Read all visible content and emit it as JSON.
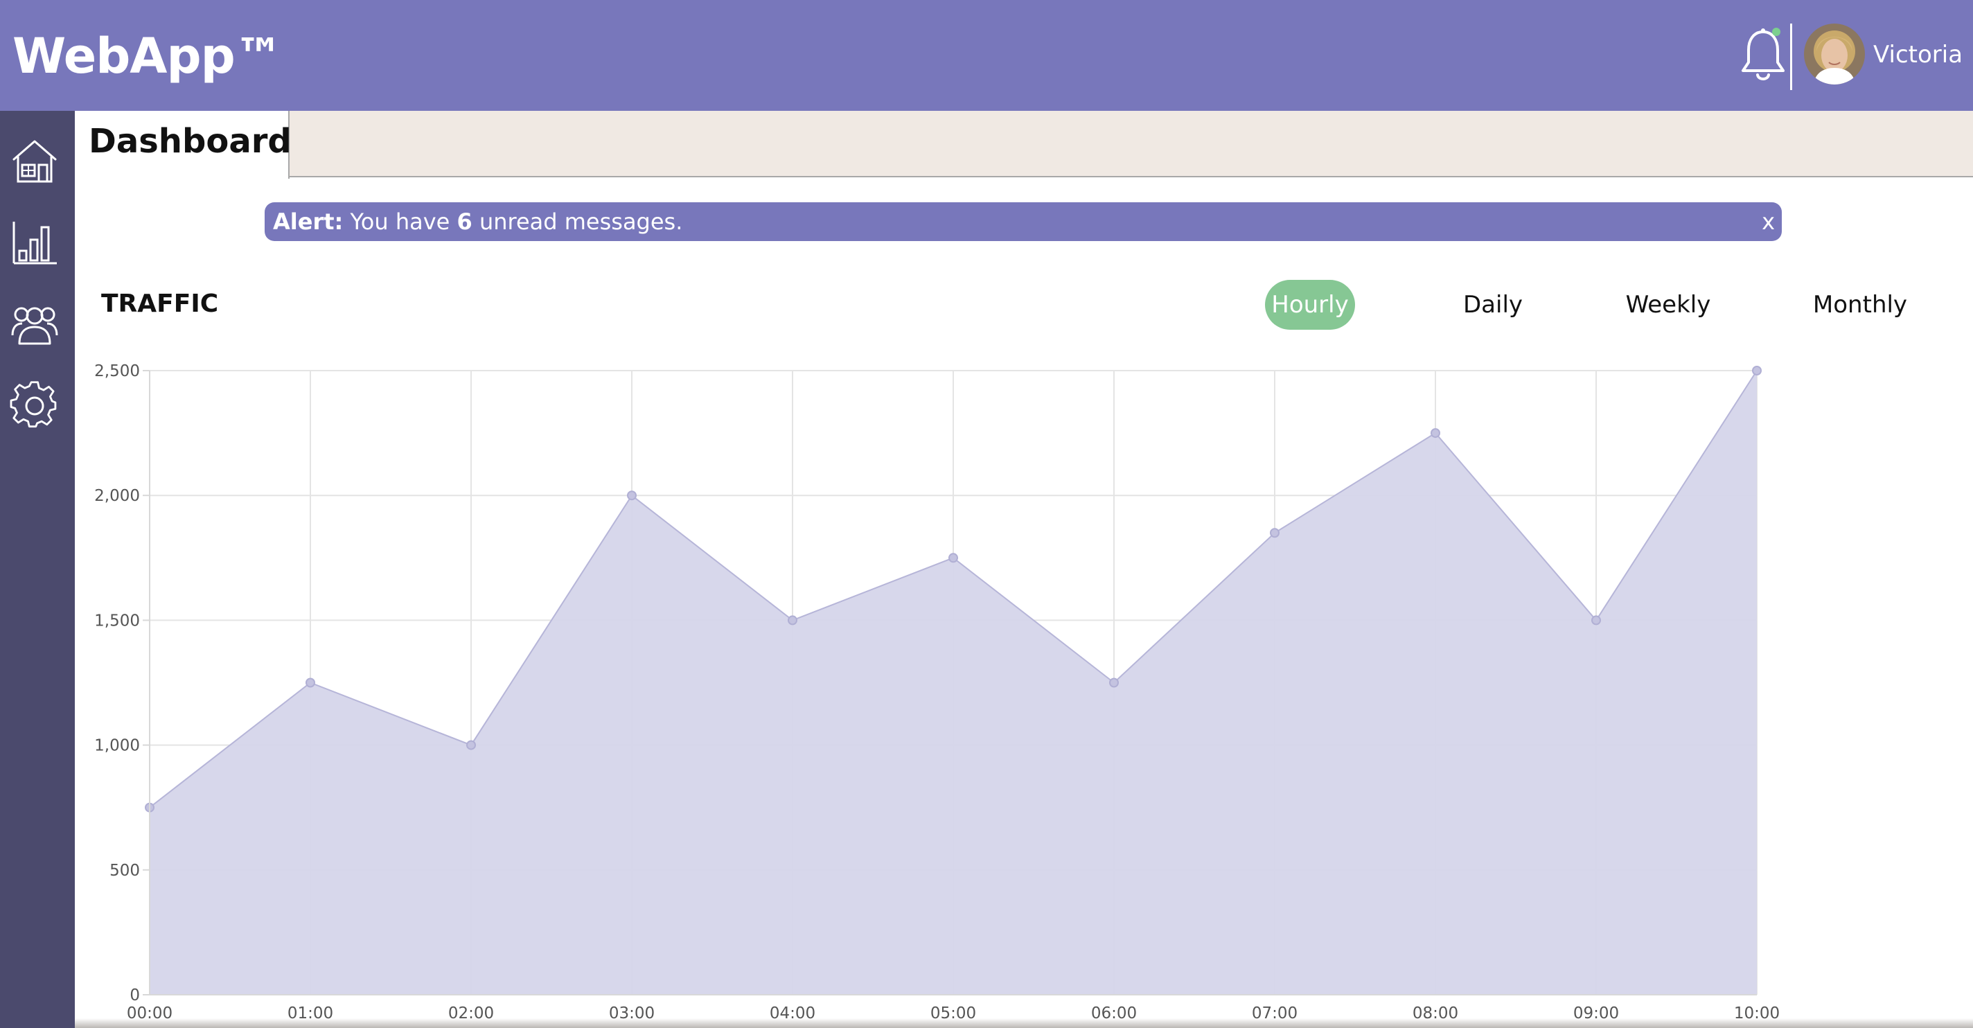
{
  "header": {
    "brand": "WebApp™",
    "user_name": "Victoria"
  },
  "sidebar": {
    "items": [
      {
        "icon": "home-icon"
      },
      {
        "icon": "bar-chart-icon"
      },
      {
        "icon": "users-icon"
      },
      {
        "icon": "gear-icon"
      }
    ]
  },
  "tabs": {
    "active": "Dashboard"
  },
  "alert": {
    "prefix": "Alert:",
    "text_before": " You have ",
    "count": "6",
    "text_after": " unread messages.",
    "close": "x"
  },
  "traffic": {
    "title": "TRAFFIC",
    "periods": [
      "Hourly",
      "Daily",
      "Weekly",
      "Monthly"
    ],
    "active_period": "Hourly"
  },
  "colors": {
    "header": "#7877bb",
    "sidebar": "#4b4a6d",
    "tabbar": "#f0e9e3",
    "active_pill": "#86c794",
    "area_fill": "#d5d5ea",
    "area_line": "#b6b5d8"
  },
  "chart_data": {
    "type": "area",
    "x": [
      "00:00",
      "01:00",
      "02:00",
      "03:00",
      "04:00",
      "05:00",
      "06:00",
      "07:00",
      "08:00",
      "09:00",
      "10:00"
    ],
    "series": [
      {
        "values": [
          750,
          1250,
          1000,
          2000,
          1500,
          1750,
          1250,
          1850,
          2250,
          1500,
          2500
        ]
      }
    ],
    "yticks": [
      "0",
      "500",
      "1,000",
      "1,500",
      "2,000",
      "2,500"
    ],
    "ylim": [
      0,
      2500
    ],
    "grid": true
  }
}
